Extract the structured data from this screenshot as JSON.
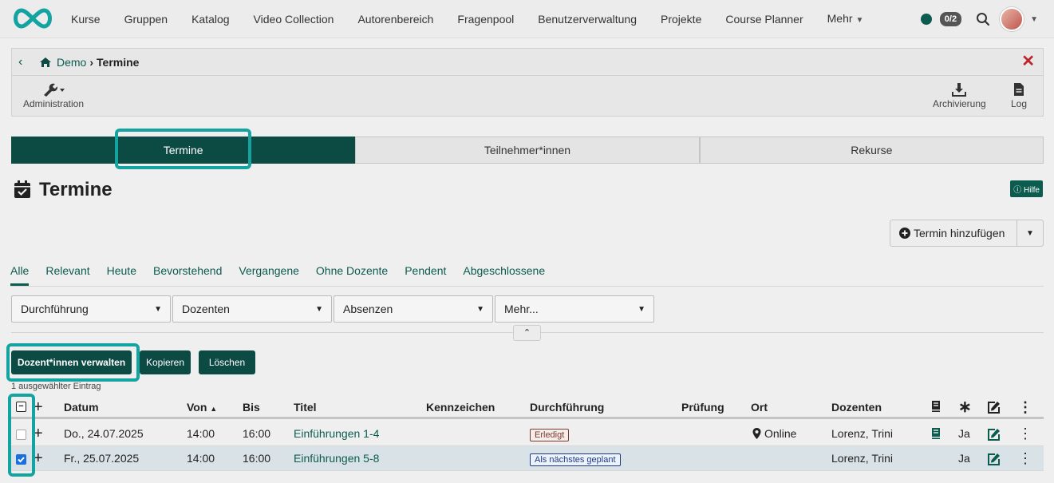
{
  "nav": {
    "items": [
      "Kurse",
      "Gruppen",
      "Katalog",
      "Video Collection",
      "Autorenbereich",
      "Fragenpool",
      "Benutzerverwaltung",
      "Projekte",
      "Course Planner",
      "Mehr"
    ],
    "badge": "0/2"
  },
  "breadcrumb": {
    "parent": "Demo",
    "current": "Termine"
  },
  "toolbar": {
    "admin_label": "Administration",
    "archive_label": "Archivierung",
    "log_label": "Log"
  },
  "segments": [
    "Termine",
    "Teilnehmer*innen",
    "Rekurse"
  ],
  "page": {
    "title": "Termine",
    "help": "Hilfe",
    "add_button": "Termin hinzufügen"
  },
  "filter_tabs": [
    "Alle",
    "Relevant",
    "Heute",
    "Bevorstehend",
    "Vergangene",
    "Ohne Dozente",
    "Pendent",
    "Abgeschlossene"
  ],
  "selects": [
    "Durchführung",
    "Dozenten",
    "Absenzen",
    "Mehr..."
  ],
  "actions": {
    "manage": "Dozent*innen verwalten",
    "copy": "Kopieren",
    "delete": "Löschen"
  },
  "selection_count": "1 ausgewählter Eintrag",
  "table": {
    "headers": {
      "datum": "Datum",
      "von": "Von",
      "bis": "Bis",
      "titel": "Titel",
      "kennzeichen": "Kennzeichen",
      "durchfuehrung": "Durchführung",
      "pruefung": "Prüfung",
      "ort": "Ort",
      "dozenten": "Dozenten"
    },
    "rows": [
      {
        "datum": "Do., 24.07.2025",
        "von": "14:00",
        "bis": "16:00",
        "titel": "Einführungen 1-4",
        "durchfuehrung": "Erledigt",
        "ort": "Online",
        "dozenten": "Lorenz, Trini",
        "flag": "Ja"
      },
      {
        "datum": "Fr., 25.07.2025",
        "von": "14:00",
        "bis": "16:00",
        "titel": "Einführungen 5-8",
        "durchfuehrung": "Als nächstes geplant",
        "ort": "",
        "dozenten": "Lorenz, Trini",
        "flag": "Ja"
      }
    ]
  },
  "colors": {
    "primary": "#0c4a44",
    "accent_link": "#0c5b4f",
    "highlight": "#13a3a0",
    "close": "#c0242b"
  }
}
